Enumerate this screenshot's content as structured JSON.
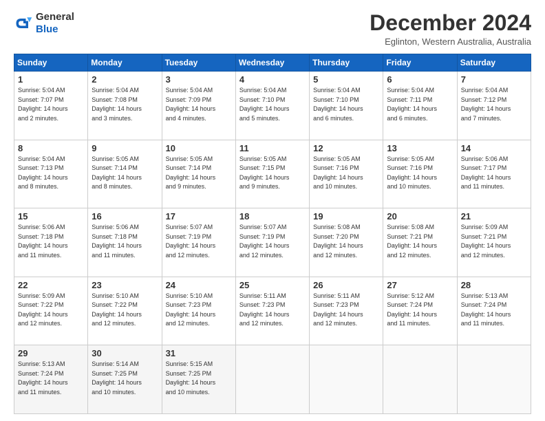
{
  "logo": {
    "general": "General",
    "blue": "Blue"
  },
  "header": {
    "month": "December 2024",
    "location": "Eglinton, Western Australia, Australia"
  },
  "weekdays": [
    "Sunday",
    "Monday",
    "Tuesday",
    "Wednesday",
    "Thursday",
    "Friday",
    "Saturday"
  ],
  "weeks": [
    [
      {
        "day": 1,
        "sunrise": "5:04 AM",
        "sunset": "7:07 PM",
        "daylight": "14 hours and 2 minutes."
      },
      {
        "day": 2,
        "sunrise": "5:04 AM",
        "sunset": "7:08 PM",
        "daylight": "14 hours and 3 minutes."
      },
      {
        "day": 3,
        "sunrise": "5:04 AM",
        "sunset": "7:09 PM",
        "daylight": "14 hours and 4 minutes."
      },
      {
        "day": 4,
        "sunrise": "5:04 AM",
        "sunset": "7:10 PM",
        "daylight": "14 hours and 5 minutes."
      },
      {
        "day": 5,
        "sunrise": "5:04 AM",
        "sunset": "7:10 PM",
        "daylight": "14 hours and 6 minutes."
      },
      {
        "day": 6,
        "sunrise": "5:04 AM",
        "sunset": "7:11 PM",
        "daylight": "14 hours and 6 minutes."
      },
      {
        "day": 7,
        "sunrise": "5:04 AM",
        "sunset": "7:12 PM",
        "daylight": "14 hours and 7 minutes."
      }
    ],
    [
      {
        "day": 8,
        "sunrise": "5:04 AM",
        "sunset": "7:13 PM",
        "daylight": "14 hours and 8 minutes."
      },
      {
        "day": 9,
        "sunrise": "5:05 AM",
        "sunset": "7:14 PM",
        "daylight": "14 hours and 8 minutes."
      },
      {
        "day": 10,
        "sunrise": "5:05 AM",
        "sunset": "7:14 PM",
        "daylight": "14 hours and 9 minutes."
      },
      {
        "day": 11,
        "sunrise": "5:05 AM",
        "sunset": "7:15 PM",
        "daylight": "14 hours and 9 minutes."
      },
      {
        "day": 12,
        "sunrise": "5:05 AM",
        "sunset": "7:16 PM",
        "daylight": "14 hours and 10 minutes."
      },
      {
        "day": 13,
        "sunrise": "5:05 AM",
        "sunset": "7:16 PM",
        "daylight": "14 hours and 10 minutes."
      },
      {
        "day": 14,
        "sunrise": "5:06 AM",
        "sunset": "7:17 PM",
        "daylight": "14 hours and 11 minutes."
      }
    ],
    [
      {
        "day": 15,
        "sunrise": "5:06 AM",
        "sunset": "7:18 PM",
        "daylight": "14 hours and 11 minutes."
      },
      {
        "day": 16,
        "sunrise": "5:06 AM",
        "sunset": "7:18 PM",
        "daylight": "14 hours and 11 minutes."
      },
      {
        "day": 17,
        "sunrise": "5:07 AM",
        "sunset": "7:19 PM",
        "daylight": "14 hours and 12 minutes."
      },
      {
        "day": 18,
        "sunrise": "5:07 AM",
        "sunset": "7:19 PM",
        "daylight": "14 hours and 12 minutes."
      },
      {
        "day": 19,
        "sunrise": "5:08 AM",
        "sunset": "7:20 PM",
        "daylight": "14 hours and 12 minutes."
      },
      {
        "day": 20,
        "sunrise": "5:08 AM",
        "sunset": "7:21 PM",
        "daylight": "14 hours and 12 minutes."
      },
      {
        "day": 21,
        "sunrise": "5:09 AM",
        "sunset": "7:21 PM",
        "daylight": "14 hours and 12 minutes."
      }
    ],
    [
      {
        "day": 22,
        "sunrise": "5:09 AM",
        "sunset": "7:22 PM",
        "daylight": "14 hours and 12 minutes."
      },
      {
        "day": 23,
        "sunrise": "5:10 AM",
        "sunset": "7:22 PM",
        "daylight": "14 hours and 12 minutes."
      },
      {
        "day": 24,
        "sunrise": "5:10 AM",
        "sunset": "7:23 PM",
        "daylight": "14 hours and 12 minutes."
      },
      {
        "day": 25,
        "sunrise": "5:11 AM",
        "sunset": "7:23 PM",
        "daylight": "14 hours and 12 minutes."
      },
      {
        "day": 26,
        "sunrise": "5:11 AM",
        "sunset": "7:23 PM",
        "daylight": "14 hours and 12 minutes."
      },
      {
        "day": 27,
        "sunrise": "5:12 AM",
        "sunset": "7:24 PM",
        "daylight": "14 hours and 11 minutes."
      },
      {
        "day": 28,
        "sunrise": "5:13 AM",
        "sunset": "7:24 PM",
        "daylight": "14 hours and 11 minutes."
      }
    ],
    [
      {
        "day": 29,
        "sunrise": "5:13 AM",
        "sunset": "7:24 PM",
        "daylight": "14 hours and 11 minutes."
      },
      {
        "day": 30,
        "sunrise": "5:14 AM",
        "sunset": "7:25 PM",
        "daylight": "14 hours and 10 minutes."
      },
      {
        "day": 31,
        "sunrise": "5:15 AM",
        "sunset": "7:25 PM",
        "daylight": "14 hours and 10 minutes."
      },
      null,
      null,
      null,
      null
    ]
  ]
}
